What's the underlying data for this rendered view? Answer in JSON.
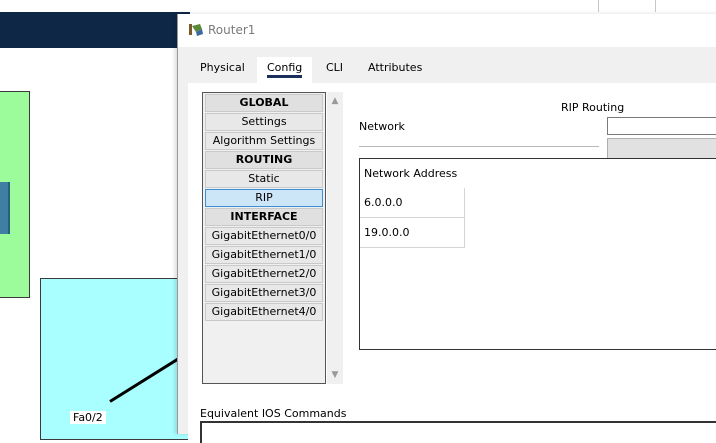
{
  "workspace": {
    "port_label": "Fa0/2"
  },
  "window": {
    "title": "Router1",
    "icon": "router-icon"
  },
  "tabs": [
    {
      "label": "Physical"
    },
    {
      "label": "Config"
    },
    {
      "label": "CLI"
    },
    {
      "label": "Attributes"
    }
  ],
  "menu": {
    "global_header": "GLOBAL",
    "settings": "Settings",
    "algorithm_settings": "Algorithm Settings",
    "routing_header": "ROUTING",
    "static": "Static",
    "rip": "RIP",
    "interface_header": "INTERFACE",
    "interfaces": [
      "GigabitEthernet0/0",
      "GigabitEthernet1/0",
      "GigabitEthernet2/0",
      "GigabitEthernet3/0",
      "GigabitEthernet4/0"
    ]
  },
  "rip": {
    "title": "RIP Routing",
    "network_label": "Network",
    "network_value": "",
    "add_button": "",
    "table_header": "Network Address",
    "networks": [
      "6.0.0.0",
      "19.0.0.0"
    ]
  },
  "footer": {
    "equiv_label": "Equivalent IOS Commands"
  },
  "colors": {
    "header_band": "#0f2747",
    "green_area": "#9cfc9c",
    "cyan_area": "#a9ffff",
    "selected_item": "#cde6f7",
    "active_tab_underline": "#1a2f5a"
  }
}
